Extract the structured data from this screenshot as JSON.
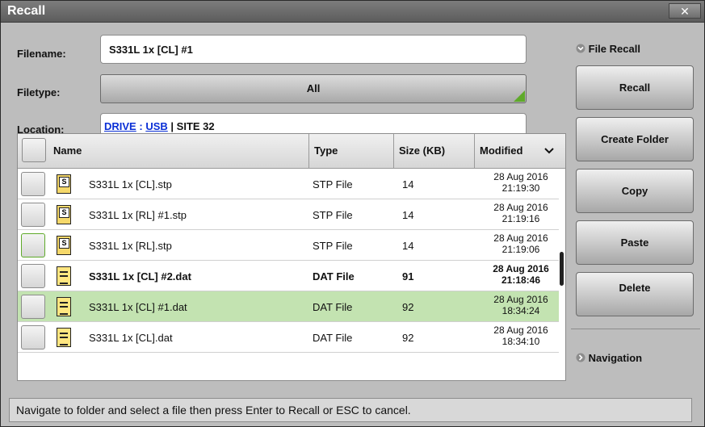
{
  "window": {
    "title": "Recall",
    "close_label": "✕"
  },
  "form": {
    "filename_label": "Filename:",
    "filename_value": "S331L 1x [CL] #1",
    "filetype_label": "Filetype:",
    "filetype_value": "All",
    "location_label": "Location:",
    "location_drive": "DRIVE",
    "location_sep1": ":",
    "location_usb": "USB",
    "location_sep2": "|",
    "location_folder": "SITE 32"
  },
  "table": {
    "headers": {
      "name": "Name",
      "type": "Type",
      "size": "Size (KB)",
      "modified": "Modified"
    },
    "rows": [
      {
        "name": "S331L 1x [CL].stp",
        "type": "STP File",
        "size": "14",
        "date": "28 Aug 2016",
        "time": "21:19:30",
        "icon": "stp-file-icon"
      },
      {
        "name": "S331L 1x [RL] #1.stp",
        "type": "STP File",
        "size": "14",
        "date": "28 Aug 2016",
        "time": "21:19:16",
        "icon": "stp-file-icon"
      },
      {
        "name": "S331L 1x [RL].stp",
        "type": "STP File",
        "size": "14",
        "date": "28 Aug 2016",
        "time": "21:19:06",
        "icon": "stp-file-icon"
      },
      {
        "name": "S331L 1x [CL] #2.dat",
        "type": "DAT File",
        "size": "91",
        "date": "28 Aug 2016",
        "time": "21:18:46",
        "icon": "dat-file-icon"
      },
      {
        "name": "S331L 1x [CL] #1.dat",
        "type": "DAT File",
        "size": "92",
        "date": "28 Aug 2016",
        "time": "18:34:24",
        "icon": "dat-file-icon",
        "selected": true
      },
      {
        "name": "S331L 1x [CL].dat",
        "type": "DAT File",
        "size": "92",
        "date": "28 Aug 2016",
        "time": "18:34:10",
        "icon": "dat-file-icon"
      }
    ]
  },
  "sidebar": {
    "file_recall_label": "File Recall",
    "recall_label": "Recall",
    "create_folder_label": "Create Folder",
    "copy_label": "Copy",
    "paste_label": "Paste",
    "delete_label": "Delete",
    "navigation_label": "Navigation"
  },
  "status": {
    "text": "Navigate to folder and select a file then press Enter to Recall or ESC to cancel."
  },
  "colors": {
    "selected_row": "#c3e3b1",
    "link": "#0a2fd6",
    "accent_triangle": "#5faa2a"
  }
}
